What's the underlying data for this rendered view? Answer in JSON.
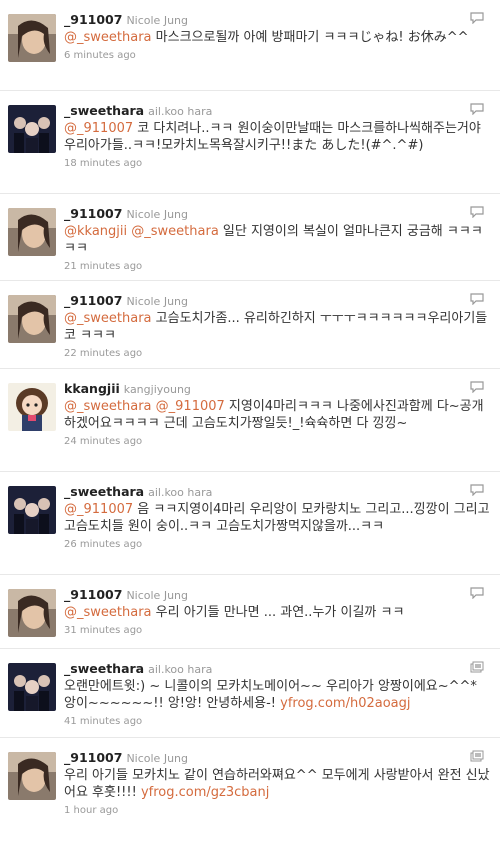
{
  "tweets": [
    {
      "screen_name": "_911007",
      "full_name": "Nicole Jung",
      "mention": "@_sweethara",
      "text": " 마스크으로될까 아예 방패마기 ㅋㅋㅋじゃね! お休み^^",
      "timestamp": "6 minutes ago",
      "avatar": "nicole-avatar-icon",
      "action_icon": "reply-icon"
    },
    {
      "screen_name": "_sweethara",
      "full_name": "ail.koo hara",
      "mention": "@_911007",
      "text": " 코 다치려나..ㅋㅋ 원이숭이만날때는 마스크를하나씩해주는거야 우리아가들..ㅋㅋ!모카치노목욕잘시키구!!また あした!(#^.^#)",
      "timestamp": "18 minutes ago",
      "avatar": "group-avatar-icon",
      "action_icon": "reply-icon"
    },
    {
      "screen_name": "_911007",
      "full_name": "Nicole Jung",
      "mention": "@kkangjii",
      "mention2": "@_sweethara",
      "text": " 일단 지영이의 복실이 얼마나큰지 궁금해 ㅋㅋㅋㅋㅋ",
      "timestamp": "21 minutes ago",
      "avatar": "nicole-avatar-icon",
      "action_icon": "reply-icon"
    },
    {
      "screen_name": "_911007",
      "full_name": "Nicole Jung",
      "mention": "@_sweethara",
      "text": " 고슴도치가좀... 유리하긴하지 ㅜㅜㅜㅋㅋㅋㅋㅋㅋ우리아기들 코 ㅋㅋㅋ",
      "timestamp": "22 minutes ago",
      "avatar": "nicole-avatar-icon",
      "action_icon": "reply-icon"
    },
    {
      "screen_name": "kkangjii",
      "full_name": "kangjiyoung",
      "mention": "@_sweethara",
      "mention2": "@_911007",
      "text": " 지영이4마리ㅋㅋㅋ 나중에사진과함께 다~공개하겠어요ㅋㅋㅋㅋ 근데 고슴도치가짱일듯!_!슉슉하면 다 낑낑~",
      "timestamp": "24 minutes ago",
      "avatar": "kangji-avatar-icon",
      "action_icon": "reply-icon"
    },
    {
      "screen_name": "_sweethara",
      "full_name": "ail.koo hara",
      "mention": "@_911007",
      "text": " 음 ㅋㅋ지영이4마리 우리앙이 모카랑치노 그리고...낑깡이 그리고 고슴도치들 원이 숭이..ㅋㅋ 고슴도치가짱먹지않을까...ㅋㅋ",
      "timestamp": "26 minutes ago",
      "avatar": "group-avatar-icon",
      "action_icon": "reply-icon"
    },
    {
      "screen_name": "_911007",
      "full_name": "Nicole Jung",
      "mention": "@_sweethara",
      "text": " 우리 아기들 만나면 ... 과연..누가 이길까 ㅋㅋ",
      "timestamp": "31 minutes ago",
      "avatar": "nicole-avatar-icon",
      "action_icon": "reply-icon"
    },
    {
      "screen_name": "_sweethara",
      "full_name": "ail.koo hara",
      "mention": "",
      "text": "오랜만에트윗:) ~ 니콜이의 모카치노메이어~~ 우리아가 앙짱이에요~^^* 앙이~~~~~~!! 앙!앙! 안녕하세용-! ",
      "link": "yfrog.com/h02aoagj",
      "timestamp": "41 minutes ago",
      "avatar": "group-avatar-icon",
      "action_icon": "image-icon"
    },
    {
      "screen_name": "_911007",
      "full_name": "Nicole Jung",
      "mention": "",
      "text": "우리 아기들 모카치노 같이 연습하러와쪄요^^ 모두에게 사랑받아서 완전 신났어요 후훗!!!! ",
      "link": "yfrog.com/gz3cbanj",
      "timestamp": "1 hour ago",
      "avatar": "nicole-avatar-icon",
      "action_icon": "image-icon"
    }
  ]
}
